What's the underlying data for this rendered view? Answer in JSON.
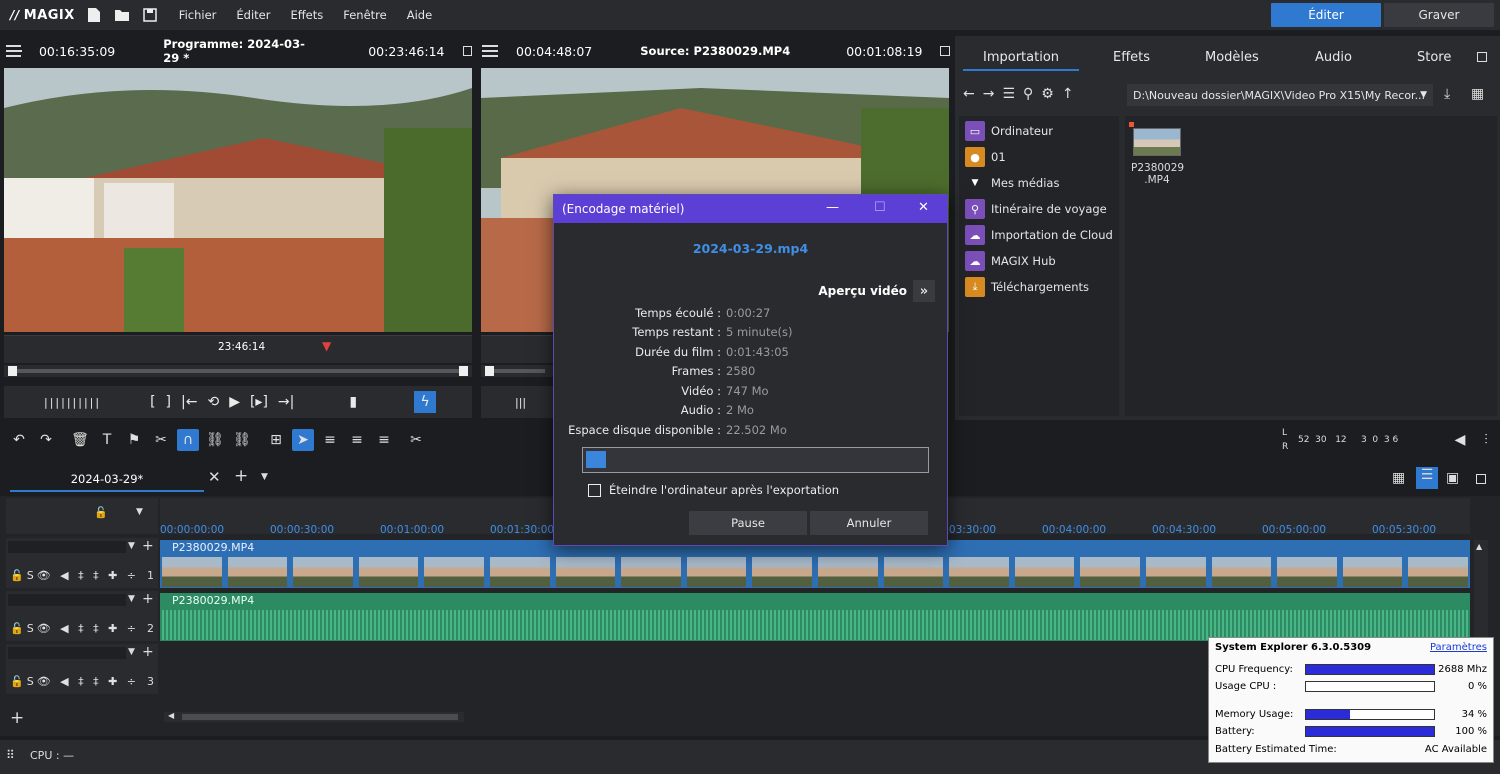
{
  "menubar": {
    "logo": "MAGIX",
    "items": [
      "Fichier",
      "Éditer",
      "Effets",
      "Fenêtre",
      "Aide"
    ],
    "edit_mode": "Éditer",
    "burn_mode": "Graver"
  },
  "program_monitor": {
    "time_left": "00:16:35:09",
    "title": "Programme: 2024-03-29 *",
    "time_right": "00:23:46:14",
    "marker_time": "23:46:14"
  },
  "source_monitor": {
    "time_left": "00:04:48:07",
    "title": "Source: P2380029.MP4",
    "time_right": "00:01:08:19"
  },
  "browser": {
    "tabs": [
      "Importation",
      "Effets",
      "Modèles",
      "Audio",
      "Store"
    ],
    "path": "D:\\Nouveau dossier\\MAGIX\\Video Pro X15\\My Recor...",
    "tree": [
      {
        "label": "Ordinateur",
        "icon": "computer-icon",
        "color": "#7a4fb8"
      },
      {
        "label": "01",
        "icon": "user-icon",
        "color": "#d68a20"
      },
      {
        "label": "Mes médias",
        "icon": "chevron-down-icon",
        "color": ""
      },
      {
        "label": "Itinéraire de voyage",
        "icon": "location-icon",
        "color": "#7a4fb8"
      },
      {
        "label": "Importation de Cloud",
        "icon": "cloud-icon",
        "color": "#7a4fb8"
      },
      {
        "label": "MAGIX Hub",
        "icon": "cloud-icon",
        "color": "#7a4fb8"
      },
      {
        "label": "Téléchargements",
        "icon": "download-icon",
        "color": "#d68a20"
      }
    ],
    "file": {
      "name_line1": "P2380029",
      "name_line2": ".MP4"
    }
  },
  "meter": {
    "left_label": "L",
    "right_label": "R",
    "scale": "52  30   12     3  0  3 6"
  },
  "timeline": {
    "project_tab": "2024-03-29*",
    "ruler": [
      "00:00:00:00",
      "00:00:30:00",
      "00:01:00:00",
      "00:01:30:00",
      "00:03:30:00",
      "00:04:00:00",
      "00:04:30:00",
      "00:05:00:00",
      "00:05:30:00"
    ],
    "tracks": [
      {
        "controls": "S",
        "number": "1",
        "clip": "P2380029.MP4"
      },
      {
        "controls": "S",
        "number": "2",
        "clip": "P2380029.MP4"
      },
      {
        "controls": "S",
        "number": "3",
        "clip": ""
      }
    ]
  },
  "dialog": {
    "title": "(Encodage matériel)",
    "filename": "2024-03-29.mp4",
    "preview_label": "Aperçu vidéo",
    "stats": [
      {
        "key": "Temps écoulé :",
        "value": "0:00:27"
      },
      {
        "key": "Temps restant :",
        "value": "5 minute(s)"
      },
      {
        "key": "Durée du film :",
        "value": "0:01:43:05"
      },
      {
        "key": "Frames :",
        "value": "2580"
      },
      {
        "key": "Vidéo :",
        "value": "747 Mo"
      },
      {
        "key": "Audio :",
        "value": "2 Mo"
      },
      {
        "key": "Espace disque disponible :",
        "value": "22.502 Mo"
      }
    ],
    "progress_percent": 6,
    "shutdown_label": "Éteindre l'ordinateur après l'exportation",
    "pause_label": "Pause",
    "cancel_label": "Annuler"
  },
  "system_explorer": {
    "title": "System Explorer",
    "version": "6.3.0.5309",
    "settings_link": "Paramètres",
    "rows": [
      {
        "label": "CPU Frequency:",
        "value": "2688 Mhz",
        "fill": 1.0
      },
      {
        "label": "Usage CPU :",
        "value": "0 %",
        "fill": 0.0
      },
      {
        "label": "Memory Usage:",
        "value": "34 %",
        "fill": 0.34
      },
      {
        "label": "Battery:",
        "value": "100 %",
        "fill": 1.0
      }
    ],
    "battery_time_label": "Battery Estimated Time:",
    "battery_time_value": "AC Available"
  },
  "status": {
    "cpu": "CPU : —"
  },
  "colors": {
    "accent": "#2f7ad0",
    "dialog_title": "#5c3fd4",
    "video_clip": "#2e6eb3",
    "audio_clip": "#2d8b63"
  }
}
